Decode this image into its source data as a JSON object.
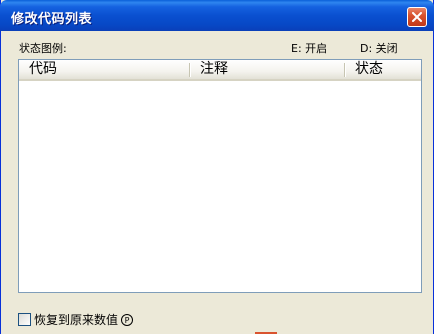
{
  "window": {
    "title": "修改代码列表",
    "close_icon": "close-icon"
  },
  "legend": {
    "label": "状态图例:",
    "enabled": "E: 开启",
    "disabled": "D: 关闭"
  },
  "table": {
    "columns": [
      "代码",
      "注释",
      "状态"
    ],
    "rows": []
  },
  "restore": {
    "label": "恢复到原来数值",
    "hotkey": "P",
    "checked": false
  },
  "colors": {
    "titlebar": "#0a50d0",
    "window_bg": "#ece9d8",
    "close_button": "#d9532e",
    "list_border": "#7f9db9"
  }
}
